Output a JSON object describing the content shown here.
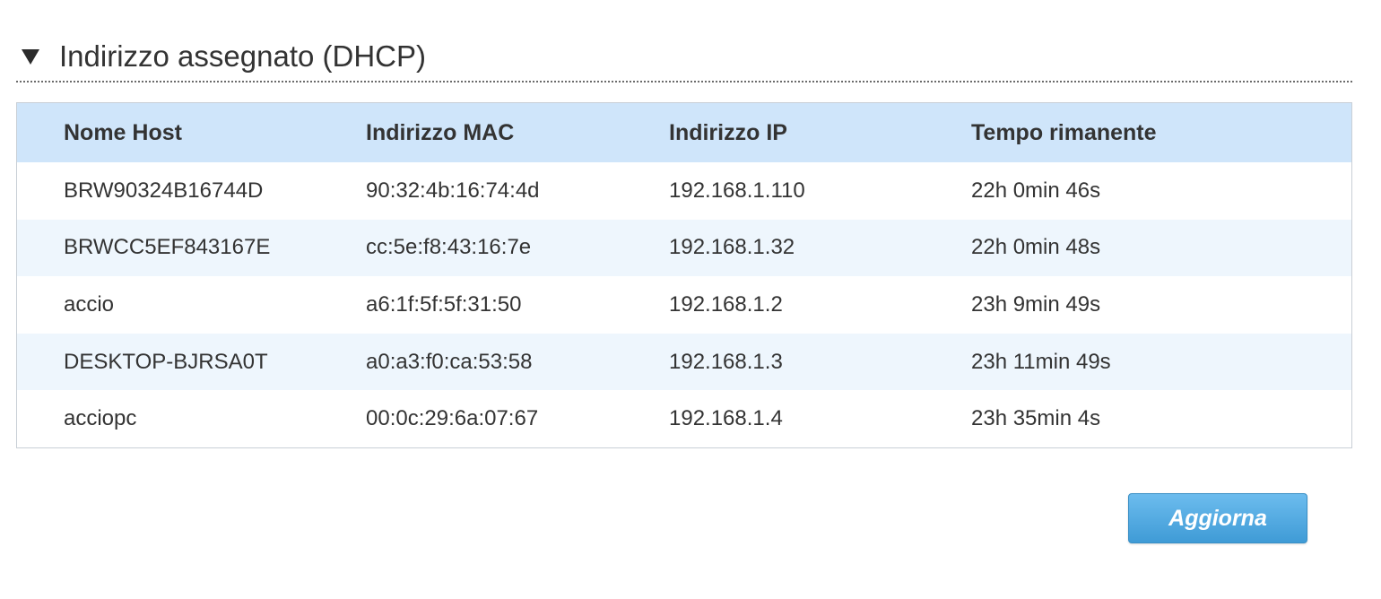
{
  "section": {
    "title": "Indirizzo assegnato (DHCP)"
  },
  "table": {
    "columns": [
      "Nome Host",
      "Indirizzo MAC",
      "Indirizzo IP",
      "Tempo rimanente"
    ],
    "rows": [
      [
        "BRW90324B16744D",
        "90:32:4b:16:74:4d",
        "192.168.1.110",
        "22h 0min 46s"
      ],
      [
        "BRWCC5EF843167E",
        "cc:5e:f8:43:16:7e",
        "192.168.1.32",
        "22h 0min 48s"
      ],
      [
        "accio",
        "a6:1f:5f:5f:31:50",
        "192.168.1.2",
        "23h 9min 49s"
      ],
      [
        "DESKTOP-BJRSA0T",
        "a0:a3:f0:ca:53:58",
        "192.168.1.3",
        "23h 11min 49s"
      ],
      [
        "acciopc",
        "00:0c:29:6a:07:67",
        "192.168.1.4",
        "23h 35min 4s"
      ]
    ]
  },
  "actions": {
    "refresh_label": "Aggiorna"
  },
  "colors": {
    "header_bg": "#cfe5fa",
    "stripe_bg": "#eef6fd",
    "button_top": "#6cbcee",
    "button_bottom": "#3f9bd6"
  }
}
